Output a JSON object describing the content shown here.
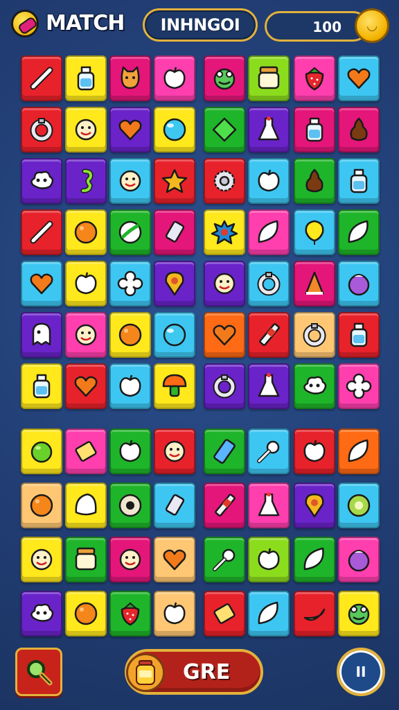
{
  "header": {
    "title": "MATCH",
    "level_label": "INHNGOI",
    "score": "100"
  },
  "footer": {
    "go_label": "GRE",
    "pause_glyph": "II"
  },
  "icons": {
    "logo": "candy-logo-icon",
    "coin": "coin-icon",
    "search": "magnifier-icon",
    "booster": "honey-jar-icon",
    "pause": "pause-icon"
  },
  "colors": {
    "background": "#24427a",
    "gold_border": "#e3b23c",
    "red_button": "#c8231b",
    "tile_red": "#e8222b",
    "tile_yellow": "#ffe81c",
    "tile_magenta": "#e4167a",
    "tile_pink": "#ff3fae",
    "tile_green": "#1fb52a",
    "tile_lime": "#8cdc1e",
    "tile_purple": "#6a23c9",
    "tile_cyan": "#3dc6f2",
    "tile_orange": "#ff6a14",
    "tile_peach": "#ffc773"
  },
  "board": {
    "upper_rows": [
      [
        [
          "red",
          "stick"
        ],
        [
          "yellow",
          "bottle"
        ],
        [
          "magenta",
          "cat"
        ],
        [
          "pink",
          "apple"
        ],
        [
          "magenta",
          "frog"
        ],
        [
          "lime",
          "jar"
        ],
        [
          "pink",
          "strawberry"
        ],
        [
          "cyan",
          "heart"
        ]
      ],
      [
        [
          "red",
          "ring"
        ],
        [
          "yellow",
          "face"
        ],
        [
          "purple",
          "heart"
        ],
        [
          "yellow",
          "bubble"
        ],
        [
          "green",
          "diamond"
        ],
        [
          "purple",
          "flask"
        ],
        [
          "magenta",
          "bottle"
        ],
        [
          "magenta",
          "pear"
        ]
      ],
      [
        [
          "purple",
          "cloud"
        ],
        [
          "purple",
          "seahorse"
        ],
        [
          "cyan",
          "face"
        ],
        [
          "red",
          "star"
        ],
        [
          "red",
          "gear"
        ],
        [
          "cyan",
          "apple"
        ],
        [
          "green",
          "pear"
        ],
        [
          "cyan",
          "bottle"
        ]
      ],
      [
        [
          "red",
          "stick"
        ],
        [
          "yellow",
          "orange"
        ],
        [
          "green",
          "ball"
        ],
        [
          "magenta",
          "tube"
        ],
        [
          "yellow",
          "splat"
        ],
        [
          "pink",
          "leaf"
        ],
        [
          "cyan",
          "balloon"
        ],
        [
          "green",
          "leaf"
        ]
      ],
      [
        [
          "cyan",
          "heart"
        ],
        [
          "yellow",
          "apple"
        ],
        [
          "cyan",
          "flower"
        ],
        [
          "purple",
          "pin"
        ],
        [
          "purple",
          "face"
        ],
        [
          "cyan",
          "ring"
        ],
        [
          "magenta",
          "cone"
        ],
        [
          "cyan",
          "plum"
        ]
      ],
      [
        [
          "purple",
          "ghost"
        ],
        [
          "pink",
          "face"
        ],
        [
          "yellow",
          "orange"
        ],
        [
          "cyan",
          "bubble"
        ],
        [
          "orange",
          "heart"
        ],
        [
          "red",
          "pencil"
        ],
        [
          "peach",
          "ring"
        ],
        [
          "red",
          "bottle"
        ]
      ],
      [
        [
          "yellow",
          "bottle"
        ],
        [
          "red",
          "heart"
        ],
        [
          "cyan",
          "apple"
        ],
        [
          "yellow",
          "mushroom"
        ],
        [
          "purple",
          "ring"
        ],
        [
          "purple",
          "flask"
        ],
        [
          "green",
          "cloud"
        ],
        [
          "pink",
          "flower"
        ]
      ]
    ],
    "lower_rows": [
      [
        [
          "yellow",
          "lime"
        ],
        [
          "pink",
          "gem"
        ],
        [
          "green",
          "apple"
        ],
        [
          "red",
          "face"
        ],
        [
          "green",
          "battery"
        ],
        [
          "cyan",
          "key"
        ],
        [
          "red",
          "apple"
        ],
        [
          "orange",
          "leaf"
        ]
      ],
      [
        [
          "peach",
          "orange"
        ],
        [
          "yellow",
          "shell"
        ],
        [
          "green",
          "donut"
        ],
        [
          "cyan",
          "tube"
        ],
        [
          "magenta",
          "pencil"
        ],
        [
          "pink",
          "flask"
        ],
        [
          "purple",
          "pin"
        ],
        [
          "cyan",
          "kiwi"
        ]
      ],
      [
        [
          "yellow",
          "face"
        ],
        [
          "green",
          "jar"
        ],
        [
          "magenta",
          "face"
        ],
        [
          "peach",
          "heart"
        ],
        [
          "green",
          "key"
        ],
        [
          "lime",
          "apple"
        ],
        [
          "green",
          "leaf"
        ],
        [
          "pink",
          "plum"
        ]
      ],
      [
        [
          "purple",
          "cloud"
        ],
        [
          "yellow",
          "orange"
        ],
        [
          "green",
          "strawberry"
        ],
        [
          "peach",
          "apple"
        ],
        [
          "red",
          "gem"
        ],
        [
          "cyan",
          "leaf"
        ],
        [
          "red",
          "banana"
        ],
        [
          "yellow",
          "frog"
        ]
      ]
    ]
  }
}
